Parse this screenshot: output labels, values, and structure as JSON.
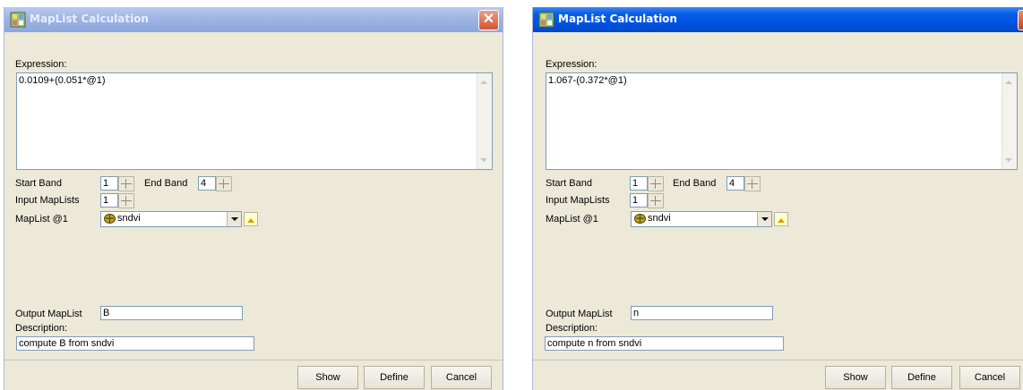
{
  "dialogs": [
    {
      "title": "MapList Calculation",
      "close_glyph": "✕",
      "expression_label": "Expression:",
      "expression": "0.0109+(0.051*@1)",
      "start_band_label": "Start Band",
      "start_band": "1",
      "end_band_label": "End Band",
      "end_band": "4",
      "input_maplists_label": "Input MapLists",
      "input_maplists": "1",
      "maplist_label": "MapList @1",
      "maplist_value": "sndvi",
      "output_label": "Output MapList",
      "output_value": "B",
      "description_label": "Description:",
      "description": "compute B from sndvi",
      "buttons": {
        "show": "Show",
        "define": "Define",
        "cancel": "Cancel"
      }
    },
    {
      "title": "MapList Calculation",
      "close_glyph": "✕",
      "expression_label": "Expression:",
      "expression": "1.067-(0.372*@1)",
      "start_band_label": "Start Band",
      "start_band": "1",
      "end_band_label": "End Band",
      "end_band": "4",
      "input_maplists_label": "Input MapLists",
      "input_maplists": "1",
      "maplist_label": "MapList @1",
      "maplist_value": "sndvi",
      "output_label": "Output MapList",
      "output_value": "n",
      "description_label": "Description:",
      "description": "compute n from sndvi",
      "buttons": {
        "show": "Show",
        "define": "Define",
        "cancel": "Cancel"
      }
    }
  ],
  "icons": {
    "app": "app-icon",
    "close": "close-icon",
    "maplist": "maplist-icon",
    "browse": "browse-icon"
  },
  "colors": {
    "dialog_bg": "#ece9d8",
    "inactive_title": "#9fb4e4",
    "active_title": "#0054e3",
    "close": "#d2552f"
  }
}
